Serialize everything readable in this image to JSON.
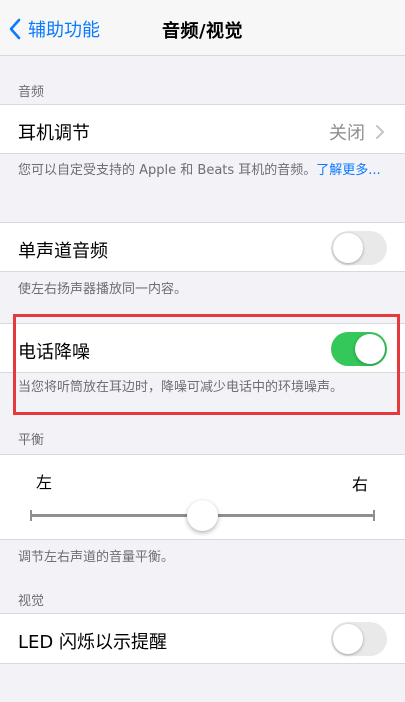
{
  "nav": {
    "back_label": "辅助功能",
    "title": "音频/视觉"
  },
  "audio_section": {
    "header": "音频",
    "headphone_accommodations": {
      "label": "耳机调节",
      "value": "关闭"
    },
    "footer_text": "您可以自定受支持的 Apple 和 Beats 耳机的音频。",
    "footer_link": "了解更多..."
  },
  "mono_audio": {
    "label": "单声道音频",
    "on": false,
    "footer": "使左右扬声器播放同一内容。"
  },
  "phone_noise_cancellation": {
    "label": "电话降噪",
    "on": true,
    "footer": "当您将听筒放在耳边时，降噪可减少电话中的环境噪声。"
  },
  "balance": {
    "header": "平衡",
    "left_label": "左",
    "right_label": "右",
    "value_fraction": 0.5,
    "footer": "调节左右声道的音量平衡。"
  },
  "visual_section": {
    "header": "视觉",
    "led_flash": {
      "label": "LED 闪烁以示提醒",
      "on": false
    }
  },
  "colors": {
    "accent": "#0a7aff",
    "toggle_on": "#34c759",
    "highlight_border": "#e6393e"
  },
  "icons": {
    "back": "chevron-left-icon",
    "disclosure": "chevron-right-icon"
  }
}
